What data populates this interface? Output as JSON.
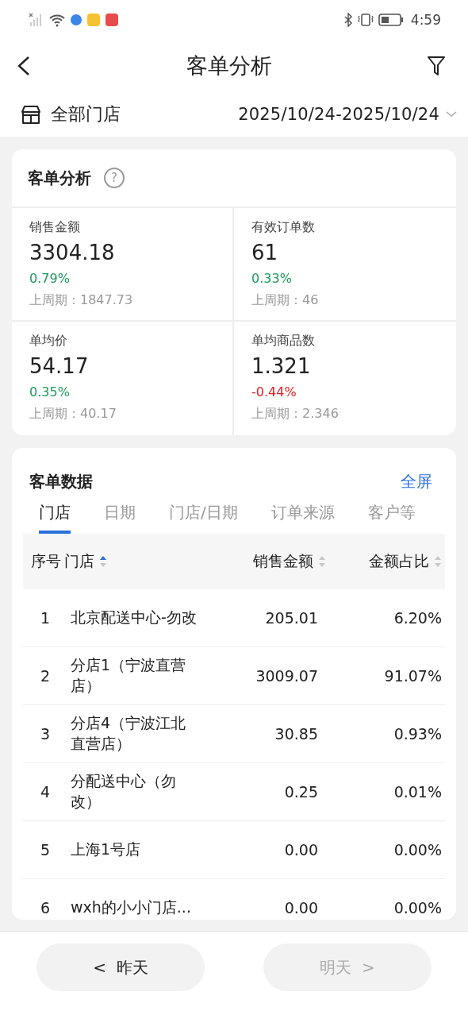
{
  "status_bar": {
    "time": "4:59"
  },
  "header": {
    "title": "客单分析"
  },
  "filter": {
    "store": "全部门店",
    "date_range": "2025/10/24-2025/10/24"
  },
  "summary": {
    "title": "客单分析",
    "help_icon": "?",
    "metrics": [
      {
        "label": "销售金额",
        "value": "3304.18",
        "change": "0.79%",
        "negative": false,
        "previous": "上周期：1847.73"
      },
      {
        "label": "有效订单数",
        "value": "61",
        "change": "0.33%",
        "negative": false,
        "previous": "上周期：46"
      },
      {
        "label": "单均价",
        "value": "54.17",
        "change": "0.35%",
        "negative": false,
        "previous": "上周期：40.17"
      },
      {
        "label": "单均商品数",
        "value": "1.321",
        "change": "-0.44%",
        "negative": true,
        "previous": "上周期：2.346"
      }
    ]
  },
  "data_section": {
    "title": "客单数据",
    "fullscreen": "全屏",
    "tabs": [
      {
        "label": "门店",
        "selected": true
      },
      {
        "label": "日期",
        "selected": false
      },
      {
        "label": "门店/日期",
        "selected": false
      },
      {
        "label": "订单来源",
        "selected": false
      },
      {
        "label": "客户等",
        "selected": false
      }
    ],
    "table": {
      "columns": [
        {
          "label": "序号",
          "kind": "plain"
        },
        {
          "label": "门店",
          "kind": "sortable",
          "sorted": true
        },
        {
          "label": "销售金额",
          "kind": "sortable",
          "sorted": false
        },
        {
          "label": "金额占比",
          "kind": "sortable",
          "sorted": false
        }
      ],
      "rows": [
        [
          "1",
          "北京配送中心-勿改",
          "205.01",
          "6.20%"
        ],
        [
          "2",
          "分店1（宁波直营店）",
          "3009.07",
          "91.07%"
        ],
        [
          "3",
          "分店4（宁波江北直营店）",
          "30.85",
          "0.93%"
        ],
        [
          "4",
          "分配送中心（勿改）",
          "0.25",
          "0.01%"
        ],
        [
          "5",
          "上海1号店",
          "0.00",
          "0.00%"
        ],
        [
          "6",
          "wxh的小小门店...",
          "0.00",
          "0.00%"
        ]
      ]
    }
  },
  "footer": {
    "buttons": [
      {
        "label": "昨天",
        "arrow": "<",
        "disabled": false
      },
      {
        "label": "明天",
        "arrow": ">",
        "disabled": true
      }
    ]
  }
}
